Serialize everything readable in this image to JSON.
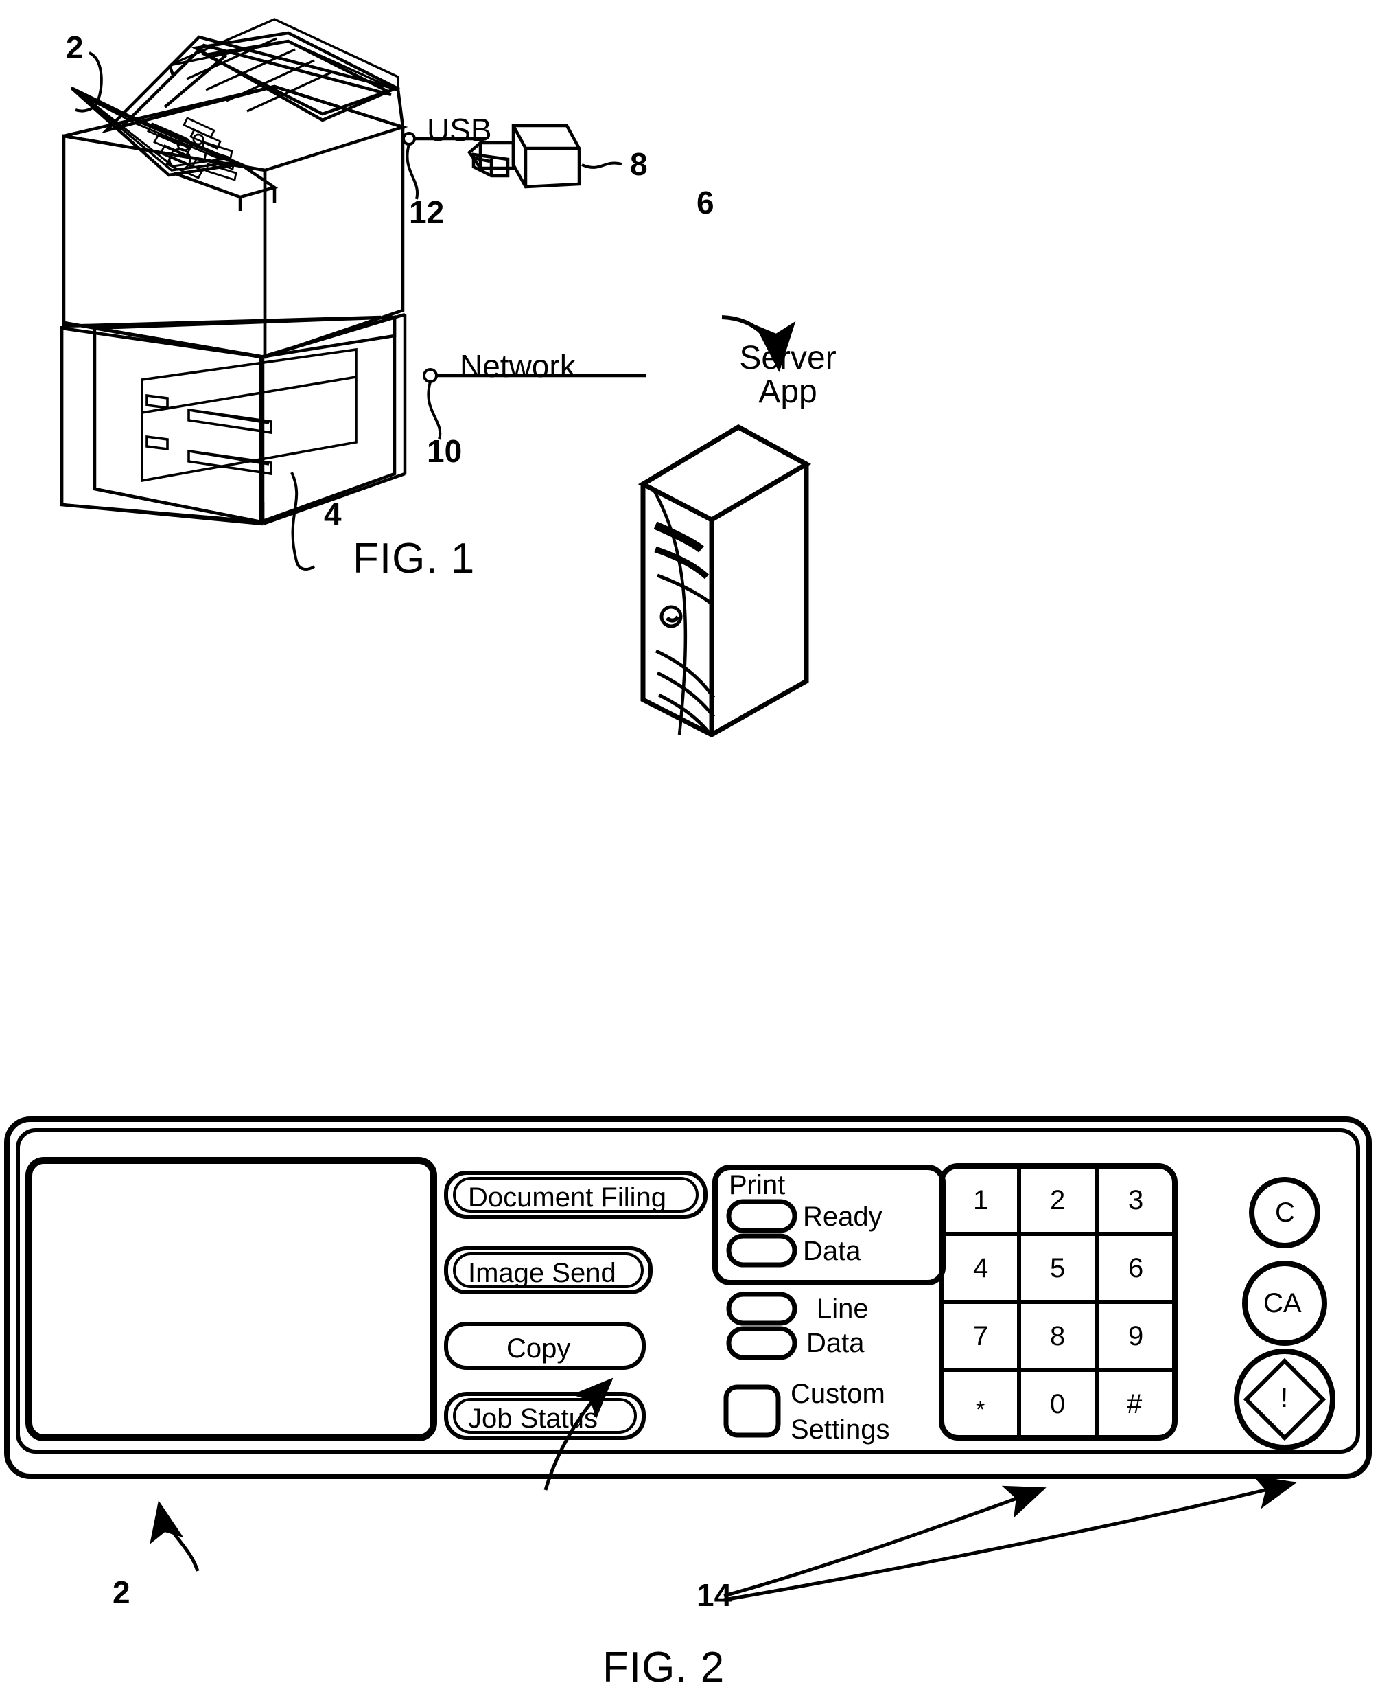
{
  "figures": [
    {
      "id": "fig1",
      "caption": "FIG. 1",
      "reference_numerals": {
        "mfp": "2",
        "cabinet": "4",
        "server": "6",
        "usb_device": "8",
        "network_port": "10",
        "usb_port": "12"
      },
      "link_labels": {
        "usb": "USB",
        "network": "Network"
      },
      "server": {
        "line1": "Server",
        "line2": "App"
      }
    },
    {
      "id": "fig2",
      "caption": "FIG. 2",
      "reference_numerals": {
        "operation_panel": "2",
        "hard_keys": "14"
      },
      "display": {
        "name": "touch-panel-display",
        "content": ""
      },
      "mode_buttons": [
        {
          "label": "Document Filing"
        },
        {
          "label": "Image Send"
        },
        {
          "label": "Copy"
        },
        {
          "label": "Job Status"
        }
      ],
      "indicator_group": {
        "title": "Print",
        "items": [
          {
            "label": "Ready"
          },
          {
            "label": "Data"
          }
        ]
      },
      "indicators": [
        {
          "label": "Line"
        },
        {
          "label": "Data"
        }
      ],
      "custom_settings": {
        "line1": "Custom",
        "line2": "Settings"
      },
      "keypad": {
        "rows": [
          [
            "1",
            "2",
            "3"
          ],
          [
            "4",
            "5",
            "6"
          ],
          [
            "7",
            "8",
            "9"
          ],
          [
            "*",
            "0",
            "#"
          ]
        ]
      },
      "round_buttons": [
        {
          "label": "C",
          "name": "clear-button"
        },
        {
          "label": "CA",
          "name": "clear-all-button"
        },
        {
          "label": "!",
          "name": "start-button"
        }
      ]
    }
  ],
  "colors": {
    "ink": "#000000",
    "paper": "#ffffff"
  }
}
